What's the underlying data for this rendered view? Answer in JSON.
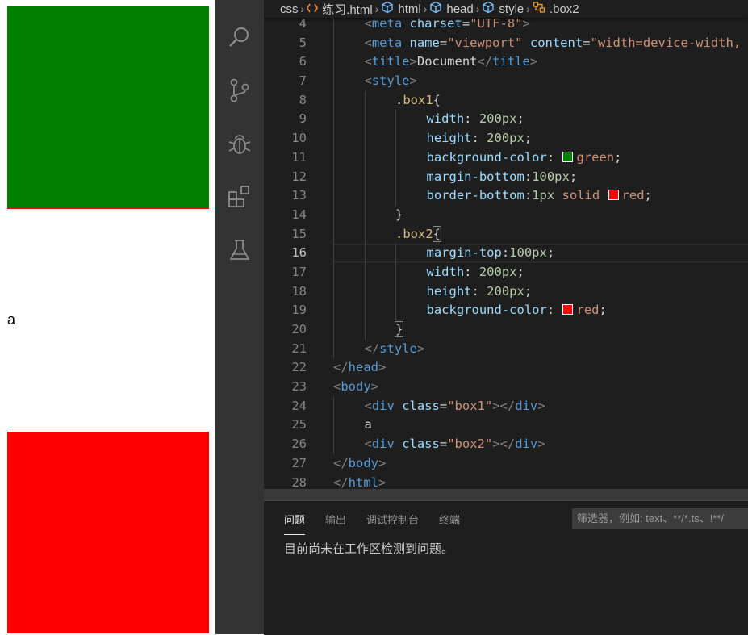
{
  "preview": {
    "text_a": "a",
    "box1_color": "#008000",
    "box1_border_color": "#ff0000",
    "box2_color": "#ff0000"
  },
  "activity_bar": {
    "icons": [
      "search-icon",
      "source-control-icon",
      "debug-icon",
      "extensions-icon",
      "testing-flask-icon"
    ]
  },
  "breadcrumb": {
    "items": [
      "css",
      "练习.html",
      "html",
      "head",
      "style",
      ".box2"
    ]
  },
  "code": {
    "lines": [
      {
        "n": "4",
        "indent": 1,
        "t": [
          [
            "br",
            "<"
          ],
          [
            "tag",
            "meta"
          ],
          [
            "txt",
            " "
          ],
          [
            "attr",
            "charset"
          ],
          [
            "txt",
            "="
          ],
          [
            "str",
            "\"UTF-8\""
          ],
          [
            "br",
            ">"
          ]
        ]
      },
      {
        "n": "5",
        "indent": 1,
        "t": [
          [
            "br",
            "<"
          ],
          [
            "tag",
            "meta"
          ],
          [
            "txt",
            " "
          ],
          [
            "attr",
            "name"
          ],
          [
            "txt",
            "="
          ],
          [
            "str",
            "\"viewport\""
          ],
          [
            "txt",
            " "
          ],
          [
            "attr",
            "content"
          ],
          [
            "txt",
            "="
          ],
          [
            "str",
            "\"width=device-width,"
          ]
        ]
      },
      {
        "n": "6",
        "indent": 1,
        "t": [
          [
            "br",
            "<"
          ],
          [
            "tag",
            "title"
          ],
          [
            "br",
            ">"
          ],
          [
            "txt",
            "Document"
          ],
          [
            "br",
            "</"
          ],
          [
            "tag",
            "title"
          ],
          [
            "br",
            ">"
          ]
        ]
      },
      {
        "n": "7",
        "indent": 1,
        "t": [
          [
            "br",
            "<"
          ],
          [
            "tag",
            "style"
          ],
          [
            "br",
            ">"
          ]
        ]
      },
      {
        "n": "8",
        "indent": 2,
        "t": [
          [
            "sel",
            ".box1"
          ],
          [
            "txt",
            "{"
          ]
        ]
      },
      {
        "n": "9",
        "indent": 3,
        "t": [
          [
            "prop",
            "width"
          ],
          [
            "txt",
            ": "
          ],
          [
            "num",
            "200px"
          ],
          [
            "txt",
            ";"
          ]
        ]
      },
      {
        "n": "10",
        "indent": 3,
        "t": [
          [
            "prop",
            "height"
          ],
          [
            "txt",
            ": "
          ],
          [
            "num",
            "200px"
          ],
          [
            "txt",
            ";"
          ]
        ]
      },
      {
        "n": "11",
        "indent": 3,
        "t": [
          [
            "prop",
            "background-color"
          ],
          [
            "txt",
            ": "
          ],
          [
            "swatch",
            "#008000"
          ],
          [
            "val",
            "green"
          ],
          [
            "txt",
            ";"
          ]
        ]
      },
      {
        "n": "12",
        "indent": 3,
        "t": [
          [
            "prop",
            "margin-bottom"
          ],
          [
            "txt",
            ":"
          ],
          [
            "num",
            "100px"
          ],
          [
            "txt",
            ";"
          ]
        ]
      },
      {
        "n": "13",
        "indent": 3,
        "t": [
          [
            "prop",
            "border-bottom"
          ],
          [
            "txt",
            ":"
          ],
          [
            "num",
            "1px"
          ],
          [
            "txt",
            " "
          ],
          [
            "val",
            "solid"
          ],
          [
            "txt",
            " "
          ],
          [
            "swatch",
            "#ff0000"
          ],
          [
            "val",
            "red"
          ],
          [
            "txt",
            ";"
          ]
        ]
      },
      {
        "n": "14",
        "indent": 2,
        "t": [
          [
            "txt",
            "}"
          ]
        ]
      },
      {
        "n": "15",
        "indent": 2,
        "t": [
          [
            "sel",
            ".box2"
          ],
          [
            "hl",
            "{"
          ]
        ]
      },
      {
        "n": "16",
        "indent": 3,
        "current": true,
        "t": [
          [
            "prop",
            "margin-top"
          ],
          [
            "txt",
            ":"
          ],
          [
            "num",
            "100px"
          ],
          [
            "txt",
            ";"
          ]
        ]
      },
      {
        "n": "17",
        "indent": 3,
        "t": [
          [
            "prop",
            "width"
          ],
          [
            "txt",
            ": "
          ],
          [
            "num",
            "200px"
          ],
          [
            "txt",
            ";"
          ]
        ]
      },
      {
        "n": "18",
        "indent": 3,
        "t": [
          [
            "prop",
            "height"
          ],
          [
            "txt",
            ": "
          ],
          [
            "num",
            "200px"
          ],
          [
            "txt",
            ";"
          ]
        ]
      },
      {
        "n": "19",
        "indent": 3,
        "t": [
          [
            "prop",
            "background-color"
          ],
          [
            "txt",
            ": "
          ],
          [
            "swatch",
            "#ff0000"
          ],
          [
            "val",
            "red"
          ],
          [
            "txt",
            ";"
          ]
        ]
      },
      {
        "n": "20",
        "indent": 2,
        "t": [
          [
            "hl",
            "}"
          ]
        ]
      },
      {
        "n": "21",
        "indent": 1,
        "t": [
          [
            "br",
            "</"
          ],
          [
            "tag",
            "style"
          ],
          [
            "br",
            ">"
          ]
        ]
      },
      {
        "n": "22",
        "indent": 0,
        "t": [
          [
            "br",
            "</"
          ],
          [
            "tag",
            "head"
          ],
          [
            "br",
            ">"
          ]
        ]
      },
      {
        "n": "23",
        "indent": 0,
        "t": [
          [
            "br",
            "<"
          ],
          [
            "tag",
            "body"
          ],
          [
            "br",
            ">"
          ]
        ]
      },
      {
        "n": "24",
        "indent": 1,
        "t": [
          [
            "br",
            "<"
          ],
          [
            "tag",
            "div"
          ],
          [
            "txt",
            " "
          ],
          [
            "attr",
            "class"
          ],
          [
            "txt",
            "="
          ],
          [
            "str",
            "\"box1\""
          ],
          [
            "br",
            "></"
          ],
          [
            "tag",
            "div"
          ],
          [
            "br",
            ">"
          ]
        ]
      },
      {
        "n": "25",
        "indent": 1,
        "t": [
          [
            "txt",
            "a"
          ]
        ]
      },
      {
        "n": "26",
        "indent": 1,
        "t": [
          [
            "br",
            "<"
          ],
          [
            "tag",
            "div"
          ],
          [
            "txt",
            " "
          ],
          [
            "attr",
            "class"
          ],
          [
            "txt",
            "="
          ],
          [
            "str",
            "\"box2\""
          ],
          [
            "br",
            "></"
          ],
          [
            "tag",
            "div"
          ],
          [
            "br",
            ">"
          ]
        ]
      },
      {
        "n": "27",
        "indent": 0,
        "t": [
          [
            "br",
            "</"
          ],
          [
            "tag",
            "body"
          ],
          [
            "br",
            ">"
          ]
        ]
      },
      {
        "n": "28",
        "indent": 0,
        "t": [
          [
            "br",
            "</"
          ],
          [
            "tag",
            "html"
          ],
          [
            "br",
            ">"
          ]
        ]
      }
    ]
  },
  "panel": {
    "tabs": [
      "问题",
      "输出",
      "调试控制台",
      "终端"
    ],
    "filter_placeholder": "筛选器，例如: text、**/*.ts、!**/",
    "message": "目前尚未在工作区检测到问题。"
  }
}
